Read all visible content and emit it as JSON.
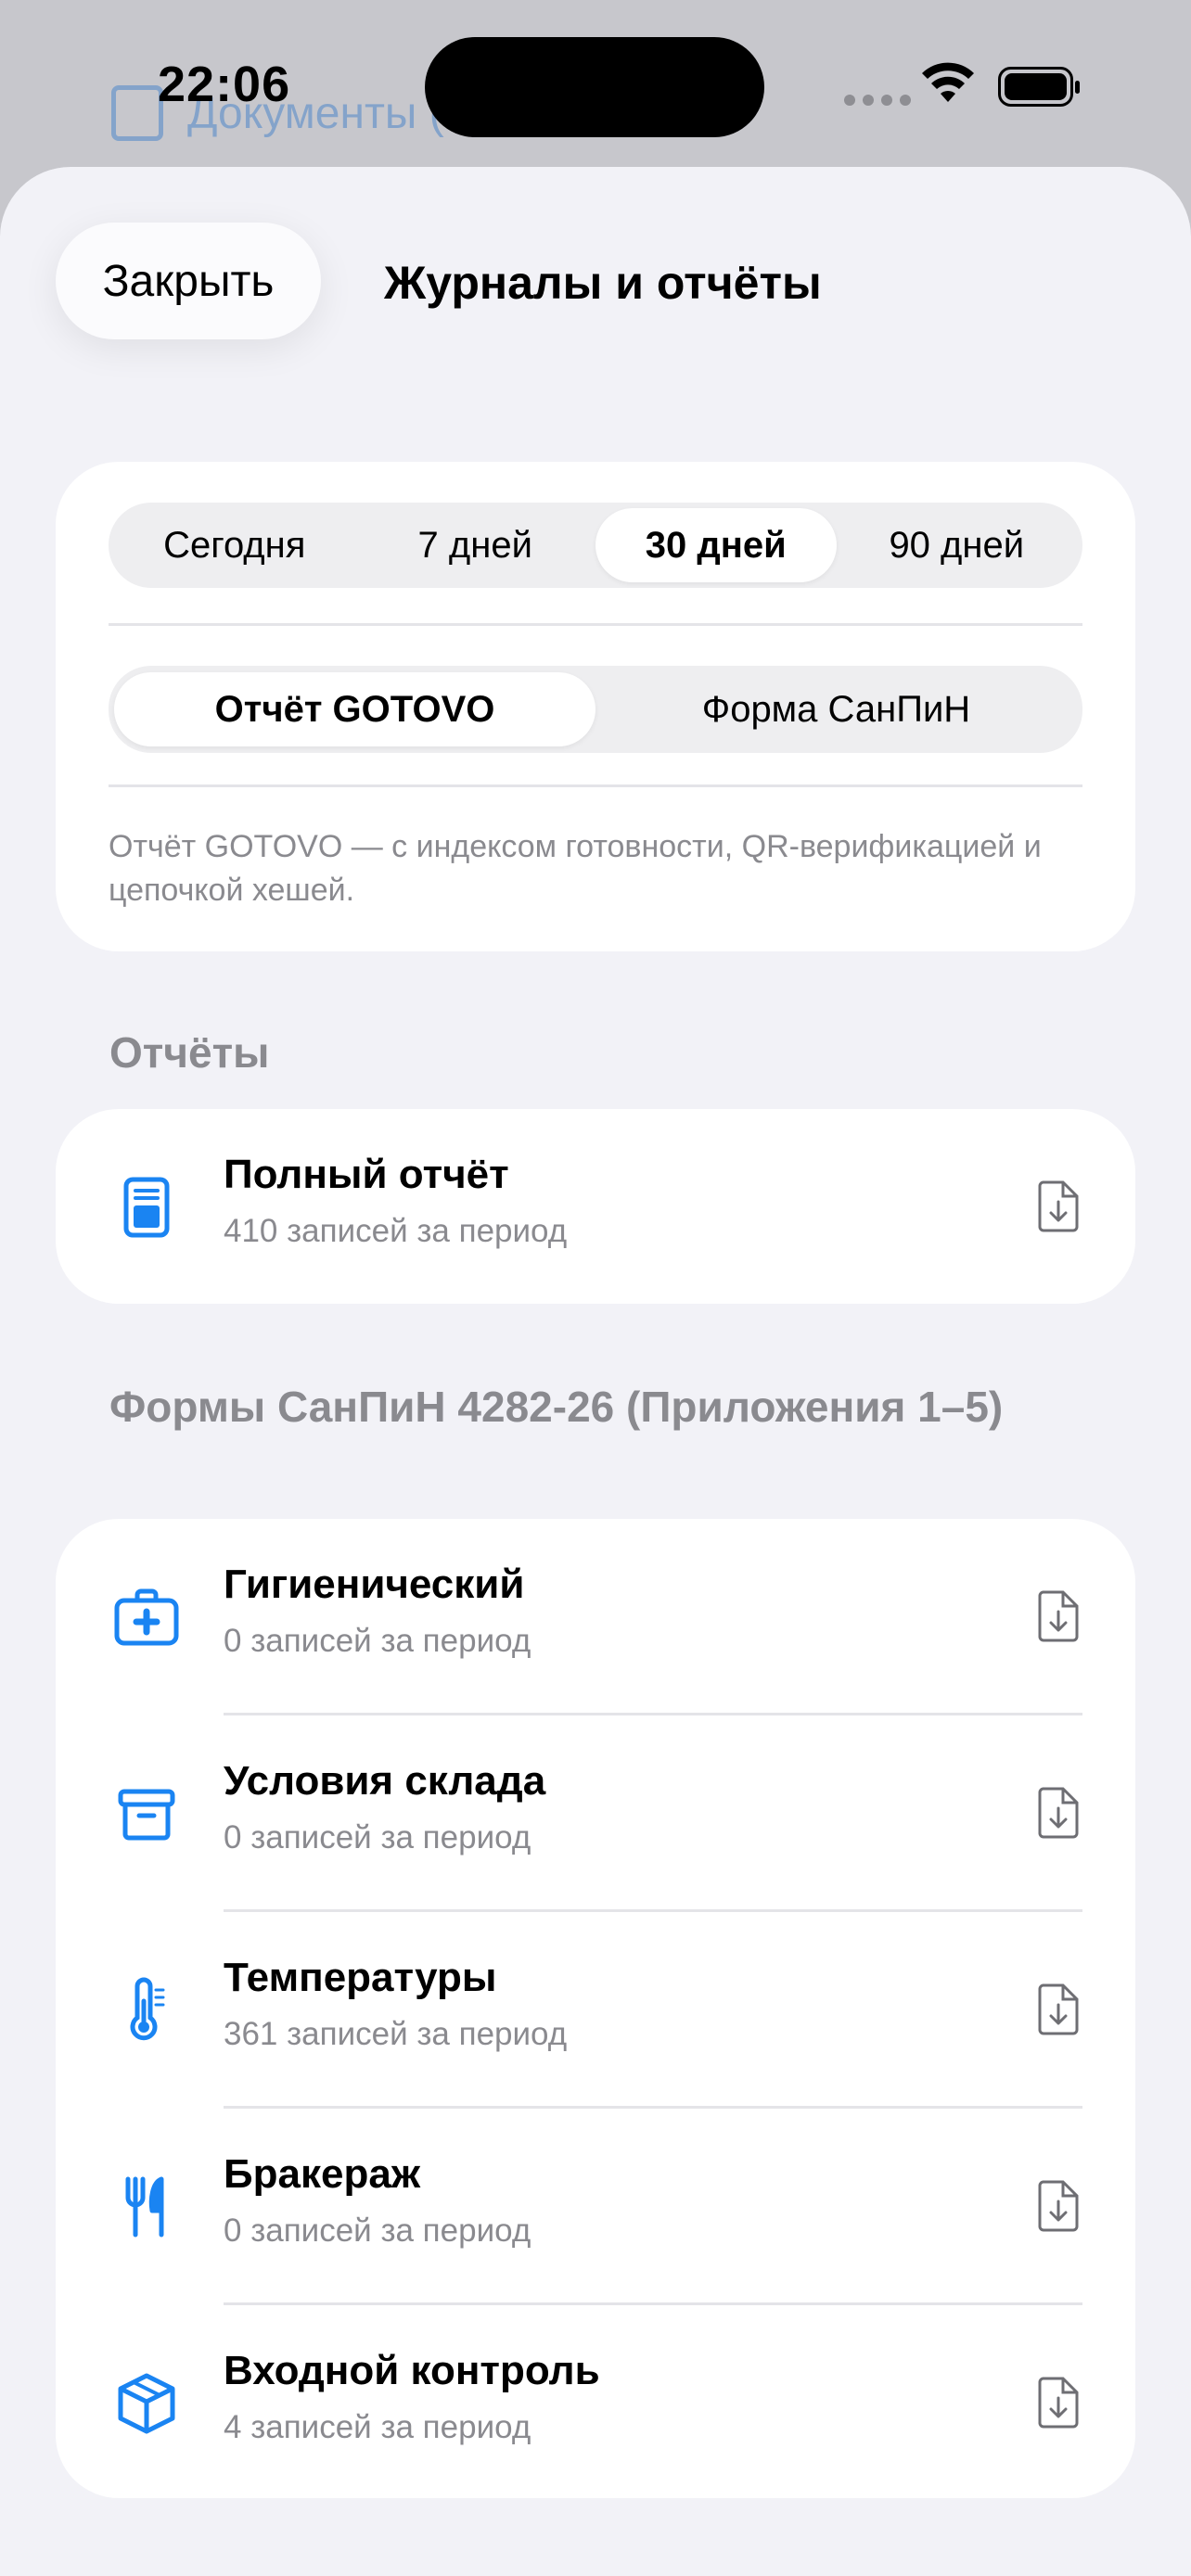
{
  "status": {
    "time": "22:06"
  },
  "background": {
    "row_text": "Документы (архив)"
  },
  "nav": {
    "close_label": "Закрыть",
    "title": "Журналы и отчёты"
  },
  "period": {
    "options": [
      "Сегодня",
      "7 дней",
      "30 дней",
      "90 дней"
    ],
    "selected": "30 дней"
  },
  "report_type": {
    "options": [
      "Отчёт GOTOVO",
      "Форма СанПиН"
    ],
    "selected": "Отчёт GOTOVO",
    "note": "Отчёт GOTOVO — с индексом готовности, QR-верификацией и цепочкой хешей."
  },
  "reports_section": {
    "title": "Отчёты",
    "items": [
      {
        "title": "Полный отчёт",
        "subtitle": "410 записей за период",
        "icon": "document-icon"
      }
    ]
  },
  "forms_section": {
    "title": "Формы СанПиН 4282-26 (Приложения 1–5)",
    "items": [
      {
        "title": "Гигиенический",
        "subtitle": "0 записей за период",
        "icon": "medkit-icon"
      },
      {
        "title": "Условия склада",
        "subtitle": "0 записей за период",
        "icon": "archive-box-icon"
      },
      {
        "title": "Температуры",
        "subtitle": "361 записей за период",
        "icon": "thermometer-icon"
      },
      {
        "title": "Бракераж",
        "subtitle": "0 записей за период",
        "icon": "fork-knife-icon"
      },
      {
        "title": "Входной контроль",
        "subtitle": "4 записей за период",
        "icon": "package-icon"
      }
    ]
  },
  "colors": {
    "accent": "#1a84f2",
    "secondary_text": "#8a8a8f",
    "sheet_bg": "#f2f2f7"
  }
}
